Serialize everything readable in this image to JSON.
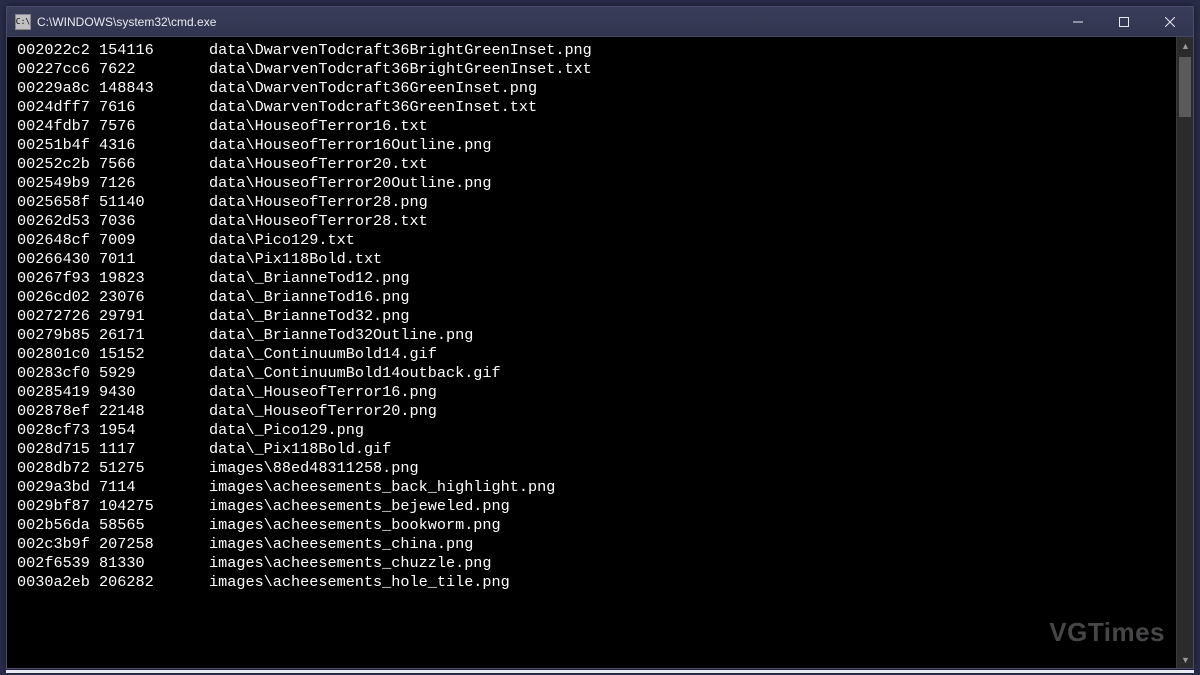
{
  "window": {
    "title": "C:\\WINDOWS\\system32\\cmd.exe",
    "icon_label": "C:\\"
  },
  "watermark": "VGTimes",
  "rows": [
    {
      "offset": "002022c2",
      "size": "154116",
      "path": "data\\DwarvenTodcraft36BrightGreenInset.png"
    },
    {
      "offset": "00227cc6",
      "size": "7622",
      "path": "data\\DwarvenTodcraft36BrightGreenInset.txt"
    },
    {
      "offset": "00229a8c",
      "size": "148843",
      "path": "data\\DwarvenTodcraft36GreenInset.png"
    },
    {
      "offset": "0024dff7",
      "size": "7616",
      "path": "data\\DwarvenTodcraft36GreenInset.txt"
    },
    {
      "offset": "0024fdb7",
      "size": "7576",
      "path": "data\\HouseofTerror16.txt"
    },
    {
      "offset": "00251b4f",
      "size": "4316",
      "path": "data\\HouseofTerror16Outline.png"
    },
    {
      "offset": "00252c2b",
      "size": "7566",
      "path": "data\\HouseofTerror20.txt"
    },
    {
      "offset": "002549b9",
      "size": "7126",
      "path": "data\\HouseofTerror20Outline.png"
    },
    {
      "offset": "0025658f",
      "size": "51140",
      "path": "data\\HouseofTerror28.png"
    },
    {
      "offset": "00262d53",
      "size": "7036",
      "path": "data\\HouseofTerror28.txt"
    },
    {
      "offset": "002648cf",
      "size": "7009",
      "path": "data\\Pico129.txt"
    },
    {
      "offset": "00266430",
      "size": "7011",
      "path": "data\\Pix118Bold.txt"
    },
    {
      "offset": "00267f93",
      "size": "19823",
      "path": "data\\_BrianneTod12.png"
    },
    {
      "offset": "0026cd02",
      "size": "23076",
      "path": "data\\_BrianneTod16.png"
    },
    {
      "offset": "00272726",
      "size": "29791",
      "path": "data\\_BrianneTod32.png"
    },
    {
      "offset": "00279b85",
      "size": "26171",
      "path": "data\\_BrianneTod32Outline.png"
    },
    {
      "offset": "002801c0",
      "size": "15152",
      "path": "data\\_ContinuumBold14.gif"
    },
    {
      "offset": "00283cf0",
      "size": "5929",
      "path": "data\\_ContinuumBold14outback.gif"
    },
    {
      "offset": "00285419",
      "size": "9430",
      "path": "data\\_HouseofTerror16.png"
    },
    {
      "offset": "002878ef",
      "size": "22148",
      "path": "data\\_HouseofTerror20.png"
    },
    {
      "offset": "0028cf73",
      "size": "1954",
      "path": "data\\_Pico129.png"
    },
    {
      "offset": "0028d715",
      "size": "1117",
      "path": "data\\_Pix118Bold.gif"
    },
    {
      "offset": "0028db72",
      "size": "51275",
      "path": "images\\88ed48311258.png"
    },
    {
      "offset": "0029a3bd",
      "size": "7114",
      "path": "images\\acheesements_back_highlight.png"
    },
    {
      "offset": "0029bf87",
      "size": "104275",
      "path": "images\\acheesements_bejeweled.png"
    },
    {
      "offset": "002b56da",
      "size": "58565",
      "path": "images\\acheesements_bookworm.png"
    },
    {
      "offset": "002c3b9f",
      "size": "207258",
      "path": "images\\acheesements_china.png"
    },
    {
      "offset": "002f6539",
      "size": "81330",
      "path": "images\\acheesements_chuzzle.png"
    },
    {
      "offset": "0030a2eb",
      "size": "206282",
      "path": "images\\acheesements_hole_tile.png"
    }
  ]
}
